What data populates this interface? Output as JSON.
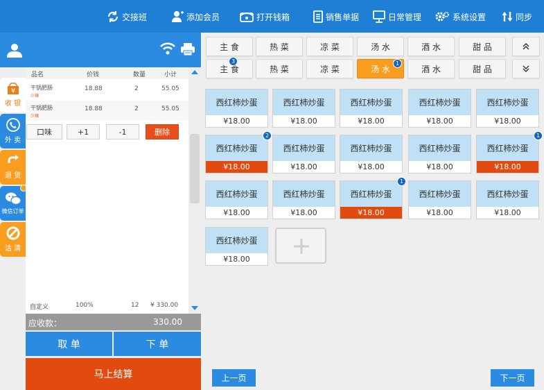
{
  "colors": {
    "topbar": "#1e7fd4",
    "accent": "#f89d1e",
    "danger": "#e84e1b",
    "selected": "#e24b10",
    "dish_header": "#bfe0f5",
    "badge": "#1565c0"
  },
  "topbar": {
    "items": [
      {
        "label": "交接班",
        "icon": "refresh-icon"
      },
      {
        "label": "添加会员",
        "icon": "add-user-icon"
      },
      {
        "label": "打开钱箱",
        "icon": "cash-drawer-icon"
      },
      {
        "label": "销售单据",
        "icon": "document-icon"
      },
      {
        "label": "日常管理",
        "icon": "monitor-icon"
      },
      {
        "label": "系统设置",
        "icon": "gear-icon"
      },
      {
        "label": "同步",
        "icon": "sync-icon"
      }
    ]
  },
  "sidebar": {
    "tabs": [
      {
        "label": "收 银",
        "icon": "cashier-icon",
        "color": "#ffffff"
      },
      {
        "label": "外 卖",
        "icon": "phone-icon",
        "color": "#2b8be0"
      },
      {
        "label": "退 货",
        "icon": "return-icon",
        "color": "#f89d1e"
      },
      {
        "label": "微信订单",
        "icon": "wechat-icon",
        "color": "#2b8be0"
      },
      {
        "label": "沽 清",
        "icon": "ban-icon",
        "color": "#f89d1e"
      }
    ]
  },
  "order": {
    "columns": [
      "品名",
      "价钱",
      "数量",
      "小计"
    ],
    "rows": [
      {
        "name": "干锅肥肠",
        "note": "少辣",
        "price": "18.88",
        "qty": "2",
        "subtotal": "55.05"
      },
      {
        "name": "干锅肥肠",
        "note": "少辣",
        "price": "18.88",
        "qty": "2",
        "subtotal": "55.05"
      }
    ],
    "actions": {
      "flavor": "口味",
      "plus": "+1",
      "minus": "-1",
      "delete": "删除"
    },
    "summary": {
      "label": "自定义",
      "discount": "100%",
      "qty": "12",
      "total": "¥ 330.00"
    },
    "receivable_label": "应收款：",
    "receivable_value": "330.00",
    "take_order": "取 单",
    "place_order": "下 单",
    "checkout": "马上结算"
  },
  "categories": {
    "row1": [
      "主 食",
      "热 菜",
      "凉 菜",
      "汤 水",
      "酒 水",
      "甜 品"
    ],
    "row2": [
      {
        "label": "主 食",
        "badge": "3"
      },
      {
        "label": "热 菜"
      },
      {
        "label": "凉 菜"
      },
      {
        "label": "汤 水",
        "badge": "1",
        "active": true
      },
      {
        "label": "酒 水"
      },
      {
        "label": "甜 品"
      }
    ]
  },
  "dishes": [
    {
      "name": "西红柿炒蛋",
      "price": "¥18.00"
    },
    {
      "name": "西红柿炒蛋",
      "price": "¥18.00"
    },
    {
      "name": "西红柿炒蛋",
      "price": "¥18.00"
    },
    {
      "name": "西红柿炒蛋",
      "price": "¥18.00"
    },
    {
      "name": "西红柿炒蛋",
      "price": "¥18.00"
    },
    {
      "name": "西红柿炒蛋",
      "price": "¥18.00",
      "badge": "2",
      "selected": true
    },
    {
      "name": "西红柿炒蛋",
      "price": "¥18.00"
    },
    {
      "name": "西红柿炒蛋",
      "price": "¥18.00"
    },
    {
      "name": "西红柿炒蛋",
      "price": "¥18.00"
    },
    {
      "name": "西红柿炒蛋",
      "price": "¥18.00",
      "badge": "1",
      "selected": true
    },
    {
      "name": "西红柿炒蛋",
      "price": "¥18.00"
    },
    {
      "name": "西红柿炒蛋",
      "price": "¥18.00"
    },
    {
      "name": "西红柿炒蛋",
      "price": "¥18.00",
      "badge": "1",
      "selected": true
    },
    {
      "name": "西红柿炒蛋",
      "price": "¥18.00"
    },
    {
      "name": "西红柿炒蛋",
      "price": "¥18.00"
    },
    {
      "name": "西红柿炒蛋",
      "price": "¥18.00"
    }
  ],
  "pagination": {
    "prev": "上一页",
    "next": "下一页"
  }
}
